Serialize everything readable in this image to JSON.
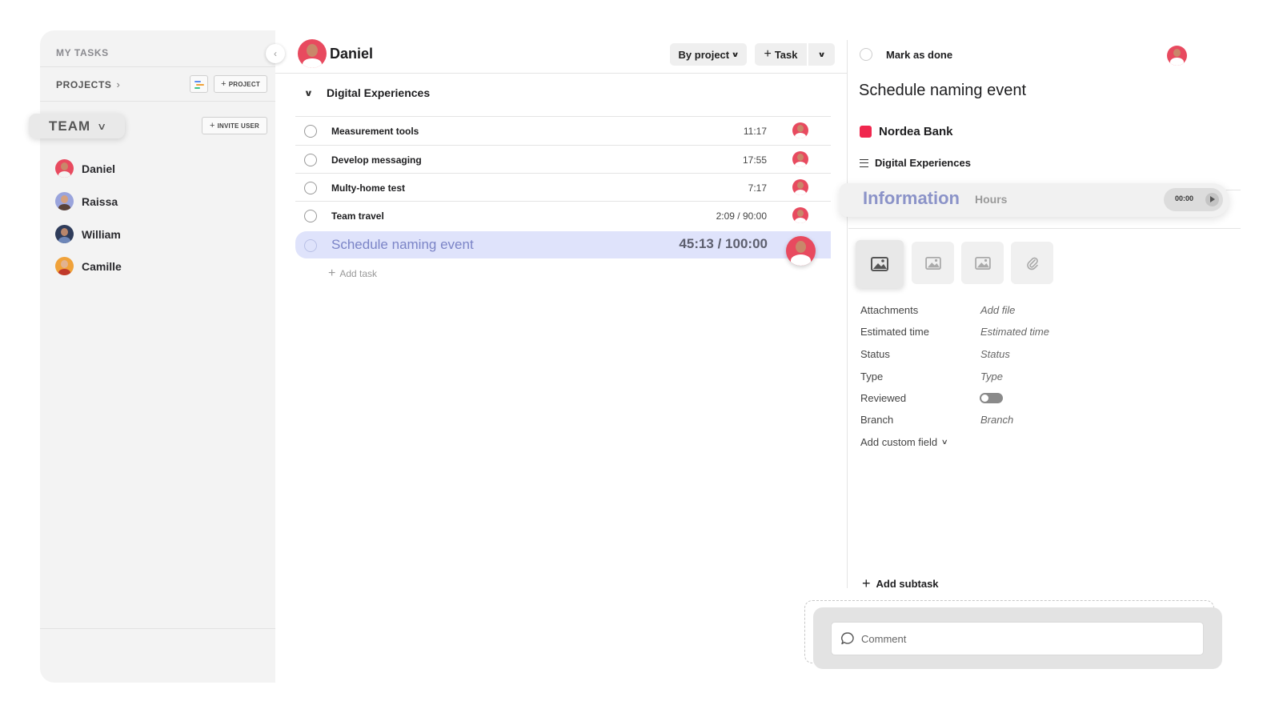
{
  "sidebar": {
    "my_tasks_label": "MY TASKS",
    "projects_label": "PROJECTS",
    "add_project_label": "PROJECT",
    "team_label": "TEAM",
    "invite_user_label": "INVITE USER",
    "collapse_icon": "chevron-left-icon",
    "members": [
      {
        "name": "Daniel",
        "avatar_color": "#e84a5f"
      },
      {
        "name": "Raissa",
        "avatar_color": "#9aa4dc"
      },
      {
        "name": "William",
        "avatar_color": "#2f3c5a"
      },
      {
        "name": "Camille",
        "avatar_color": "#f0a23a"
      }
    ]
  },
  "main": {
    "user_name": "Daniel",
    "group_by_label": "By project",
    "add_task_button_label": "Task",
    "group": {
      "title": "Digital Experiences",
      "tasks": [
        {
          "name": "Measurement tools",
          "time": "11:17"
        },
        {
          "name": "Develop messaging",
          "time": "17:55"
        },
        {
          "name": "Multy-home test",
          "time": "7:17"
        },
        {
          "name": "Team travel",
          "time": "2:09 / 90:00"
        },
        {
          "name": "Schedule naming event",
          "time": "45:13 / 100:00",
          "selected": true
        }
      ],
      "add_task_label": "Add task"
    }
  },
  "detail": {
    "mark_done_label": "Mark as done",
    "title": "Schedule naming event",
    "client": {
      "name": "Nordea Bank",
      "color": "#f0274e"
    },
    "project": "Digital Experiences",
    "tabs": {
      "info": "Information",
      "hours": "Hours"
    },
    "timer": "00:00",
    "fields": [
      {
        "label": "Attachments",
        "value": "Add file"
      },
      {
        "label": "Estimated time",
        "value": "Estimated time"
      },
      {
        "label": "Status",
        "value": "Status"
      },
      {
        "label": "Type",
        "value": "Type"
      },
      {
        "label": "Reviewed",
        "value": ""
      },
      {
        "label": "Branch",
        "value": "Branch"
      }
    ],
    "reviewed_on": false,
    "add_custom_field_label": "Add custom field",
    "add_subtask_label": "Add subtask",
    "comment_placeholder": "Comment"
  },
  "colors": {
    "accent": "#8b93c8",
    "selected_row": "#dfe3fb",
    "avatar_red": "#e84a5f"
  }
}
